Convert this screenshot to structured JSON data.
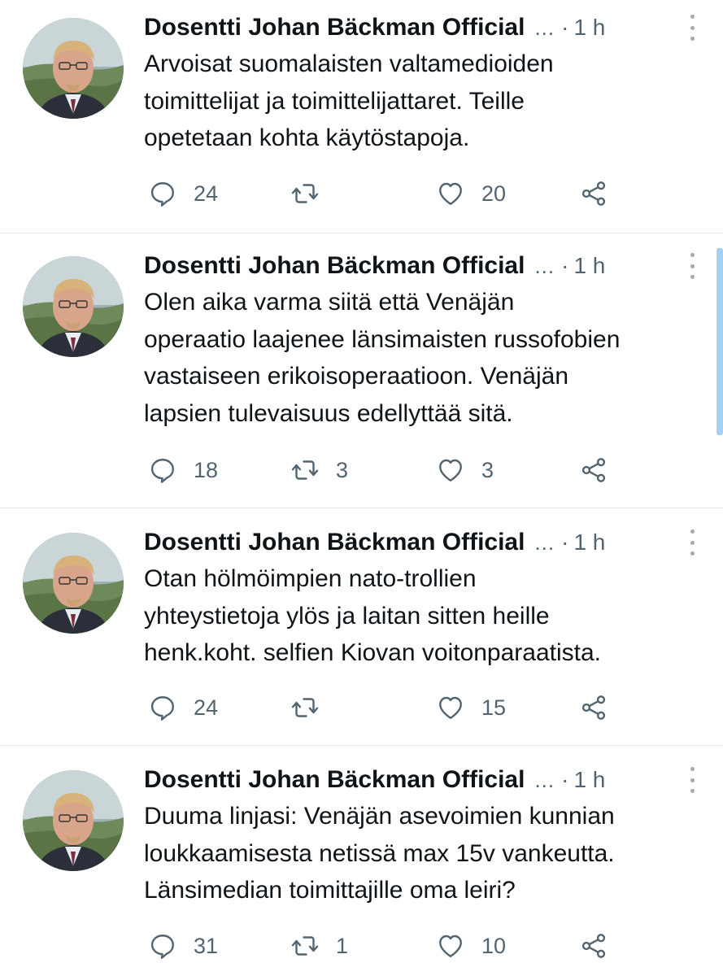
{
  "icons": {
    "reply": "speech-bubble-icon",
    "retweet": "retweet-arrows-icon",
    "like": "heart-icon",
    "share": "share-nodes-icon",
    "more": "vertical-dots-icon"
  },
  "colors": {
    "icon": "#536471",
    "text": "#0f1419",
    "meta": "#536471",
    "divider": "#e6e9ea"
  },
  "tweets": [
    {
      "author": "Dosentti Johan Bäckman Official",
      "ellipsis": "...",
      "separator": "·",
      "time": "1 h",
      "text": "Arvoisat suomalaisten valtamedioiden\ntoimittelijat ja toimittelijattaret. Teille\nopetetaan kohta käytöstapoja.",
      "replies": "24",
      "retweets": "",
      "likes": "20"
    },
    {
      "author": "Dosentti Johan Bäckman Official",
      "ellipsis": "...",
      "separator": "·",
      "time": "1 h",
      "text": "Olen aika varma siitä että Venäjän\noperaatio laajenee länsimaisten russofobien\nvastaiseen erikoisoperaatioon. Venäjän\nlapsien tulevaisuus edellyttää sitä.",
      "replies": "18",
      "retweets": "3",
      "likes": "3"
    },
    {
      "author": "Dosentti Johan Bäckman Official",
      "ellipsis": "...",
      "separator": "·",
      "time": "1 h",
      "text": "Otan hölmöimpien nato-trollien\nyhteystietoja ylös ja laitan sitten heille\nhenk.koht. selfien Kiovan voitonparaatista.",
      "replies": "24",
      "retweets": "",
      "likes": "15"
    },
    {
      "author": "Dosentti Johan Bäckman Official",
      "ellipsis": "...",
      "separator": "·",
      "time": "1 h",
      "text": "Duuma linjasi: Venäjän asevoimien kunnian\nloukkaamisesta netissä max 15v vankeutta.\nLänsimedian toimittajille oma leiri?",
      "replies": "31",
      "retweets": "1",
      "likes": "10"
    }
  ]
}
